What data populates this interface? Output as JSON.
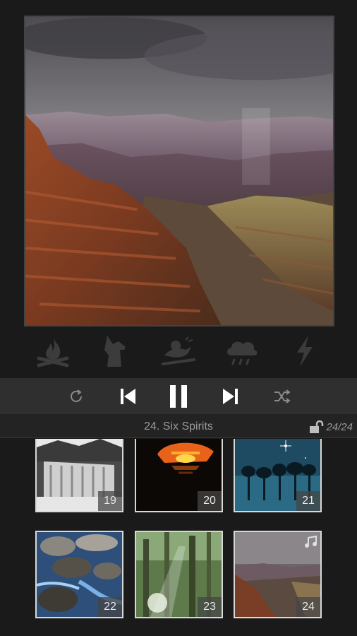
{
  "now_playing": {
    "title": "24. Six Spirits",
    "counter": "24/24"
  },
  "ambient_icons": [
    "campfire-icon",
    "wolf-icon",
    "bird-icon",
    "rain-cloud-icon",
    "lightning-icon"
  ],
  "controls": [
    "repeat-icon",
    "previous-track-icon",
    "pause-icon",
    "next-track-icon",
    "shuffle-icon"
  ],
  "tiles": [
    {
      "number": "19",
      "scene": "frozen waterfall"
    },
    {
      "number": "20",
      "scene": "sunset cave"
    },
    {
      "number": "21",
      "scene": "night trees stars"
    },
    {
      "number": "22",
      "scene": "rocky stream"
    },
    {
      "number": "23",
      "scene": "sunlit forest"
    },
    {
      "number": "24",
      "scene": "canyon storm"
    }
  ],
  "colors": {
    "background": "#1a1a1a",
    "control_bar": "#2f2f2f",
    "ambient_icon": "#3c3c3c",
    "tile_border": "#d8d8d8"
  }
}
